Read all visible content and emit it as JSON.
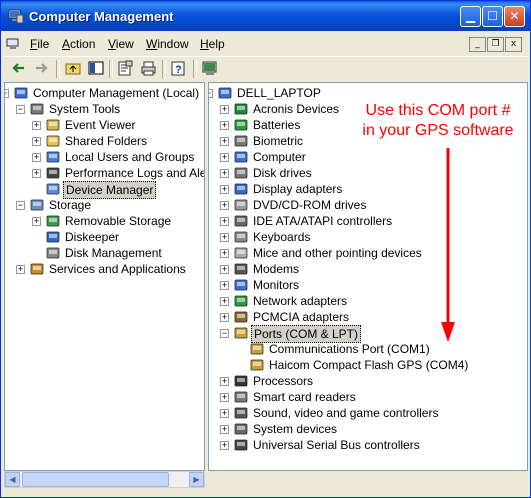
{
  "window": {
    "title": "Computer Management"
  },
  "menu": [
    {
      "label": "File",
      "key": "F"
    },
    {
      "label": "Action",
      "key": "A"
    },
    {
      "label": "View",
      "key": "V"
    },
    {
      "label": "Window",
      "key": "W"
    },
    {
      "label": "Help",
      "key": "H"
    }
  ],
  "left_tree": [
    {
      "label": "Computer Management (Local)",
      "depth": 0,
      "expander": "-",
      "icon": "computer-management-icon"
    },
    {
      "label": "System Tools",
      "depth": 1,
      "expander": "-",
      "icon": "system-tools-icon"
    },
    {
      "label": "Event Viewer",
      "depth": 2,
      "expander": "+",
      "icon": "event-viewer-icon"
    },
    {
      "label": "Shared Folders",
      "depth": 2,
      "expander": "+",
      "icon": "shared-folders-icon"
    },
    {
      "label": "Local Users and Groups",
      "depth": 2,
      "expander": "+",
      "icon": "users-icon"
    },
    {
      "label": "Performance Logs and Alerts",
      "depth": 2,
      "expander": "+",
      "icon": "performance-icon"
    },
    {
      "label": "Device Manager",
      "depth": 2,
      "expander": "",
      "icon": "device-manager-icon",
      "selected": true
    },
    {
      "label": "Storage",
      "depth": 1,
      "expander": "-",
      "icon": "storage-icon"
    },
    {
      "label": "Removable Storage",
      "depth": 2,
      "expander": "+",
      "icon": "removable-storage-icon"
    },
    {
      "label": "Diskeeper",
      "depth": 2,
      "expander": "",
      "icon": "diskeeper-icon"
    },
    {
      "label": "Disk Management",
      "depth": 2,
      "expander": "",
      "icon": "disk-management-icon"
    },
    {
      "label": "Services and Applications",
      "depth": 1,
      "expander": "+",
      "icon": "services-icon"
    }
  ],
  "right_tree": [
    {
      "label": "DELL_LAPTOP",
      "depth": 0,
      "expander": "-",
      "icon": "computer-icon"
    },
    {
      "label": "Acronis Devices",
      "depth": 1,
      "expander": "+",
      "icon": "acronis-icon"
    },
    {
      "label": "Batteries",
      "depth": 1,
      "expander": "+",
      "icon": "battery-icon"
    },
    {
      "label": "Biometric",
      "depth": 1,
      "expander": "+",
      "icon": "biometric-icon"
    },
    {
      "label": "Computer",
      "depth": 1,
      "expander": "+",
      "icon": "computer-icon"
    },
    {
      "label": "Disk drives",
      "depth": 1,
      "expander": "+",
      "icon": "disk-drive-icon"
    },
    {
      "label": "Display adapters",
      "depth": 1,
      "expander": "+",
      "icon": "display-icon"
    },
    {
      "label": "DVD/CD-ROM drives",
      "depth": 1,
      "expander": "+",
      "icon": "dvd-icon"
    },
    {
      "label": "IDE ATA/ATAPI controllers",
      "depth": 1,
      "expander": "+",
      "icon": "ide-icon"
    },
    {
      "label": "Keyboards",
      "depth": 1,
      "expander": "+",
      "icon": "keyboard-icon"
    },
    {
      "label": "Mice and other pointing devices",
      "depth": 1,
      "expander": "+",
      "icon": "mouse-icon"
    },
    {
      "label": "Modems",
      "depth": 1,
      "expander": "+",
      "icon": "modem-icon"
    },
    {
      "label": "Monitors",
      "depth": 1,
      "expander": "+",
      "icon": "monitor-icon"
    },
    {
      "label": "Network adapters",
      "depth": 1,
      "expander": "+",
      "icon": "network-icon"
    },
    {
      "label": "PCMCIA adapters",
      "depth": 1,
      "expander": "+",
      "icon": "pcmcia-icon"
    },
    {
      "label": "Ports (COM & LPT)",
      "depth": 1,
      "expander": "-",
      "icon": "port-icon",
      "selected": true
    },
    {
      "label": "Communications Port (COM1)",
      "depth": 2,
      "expander": "",
      "icon": "port-icon"
    },
    {
      "label": "Haicom Compact Flash GPS (COM4)",
      "depth": 2,
      "expander": "",
      "icon": "port-icon"
    },
    {
      "label": "Processors",
      "depth": 1,
      "expander": "+",
      "icon": "processor-icon"
    },
    {
      "label": "Smart card readers",
      "depth": 1,
      "expander": "+",
      "icon": "smartcard-icon"
    },
    {
      "label": "Sound, video and game controllers",
      "depth": 1,
      "expander": "+",
      "icon": "sound-icon"
    },
    {
      "label": "System devices",
      "depth": 1,
      "expander": "+",
      "icon": "system-devices-icon"
    },
    {
      "label": "Universal Serial Bus controllers",
      "depth": 1,
      "expander": "+",
      "icon": "usb-icon"
    }
  ],
  "annotation": {
    "line1": "Use this COM port #",
    "line2": "in your GPS software",
    "color": "#ff0000"
  },
  "colors": {
    "title_bar": "#0855dd",
    "chrome": "#ece9d8"
  }
}
